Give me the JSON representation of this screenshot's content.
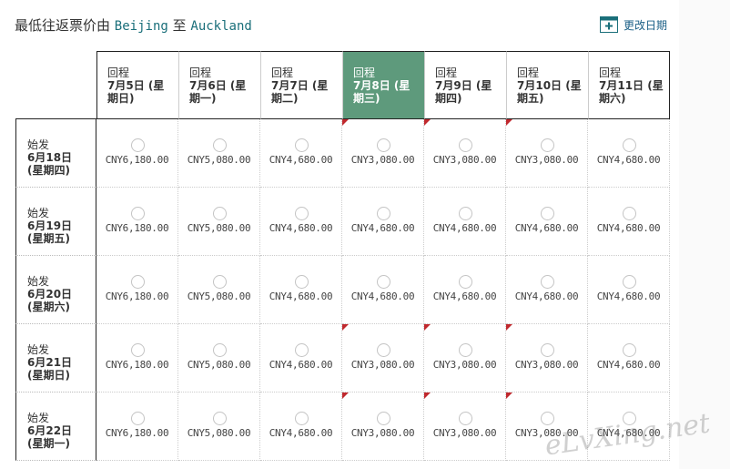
{
  "header": {
    "title_prefix": "最低往返票价由",
    "origin": "Beijing",
    "to": "至",
    "destination": "Auckland",
    "change_date_label": "更改日期"
  },
  "colors": {
    "selected_header": "#5e9a7c",
    "flag": "#c0282d",
    "link": "#1a5f86"
  },
  "columns": [
    {
      "dir": "回程",
      "date": "7月5日 (星期日)"
    },
    {
      "dir": "回程",
      "date": "7月6日 (星期一)"
    },
    {
      "dir": "回程",
      "date": "7月7日 (星期二)"
    },
    {
      "dir": "回程",
      "date": "7月8日 (星期三)",
      "selected": true
    },
    {
      "dir": "回程",
      "date": "7月9日 (星期四)"
    },
    {
      "dir": "回程",
      "date": "7月10日 (星期五)"
    },
    {
      "dir": "回程",
      "date": "7月11日 (星期六)"
    }
  ],
  "rows": [
    {
      "dir": "始发",
      "date": "6月18日 (星期四)",
      "prices": [
        "CNY6,180.00",
        "CNY5,080.00",
        "CNY4,680.00",
        "CNY3,080.00",
        "CNY3,080.00",
        "CNY3,080.00",
        "CNY4,680.00"
      ],
      "flags": [
        false,
        false,
        false,
        true,
        true,
        true,
        false
      ]
    },
    {
      "dir": "始发",
      "date": "6月19日 (星期五)",
      "prices": [
        "CNY6,180.00",
        "CNY5,080.00",
        "CNY4,680.00",
        "CNY4,680.00",
        "CNY4,680.00",
        "CNY4,680.00",
        "CNY4,680.00"
      ],
      "flags": [
        false,
        false,
        false,
        false,
        false,
        false,
        false
      ]
    },
    {
      "dir": "始发",
      "date": "6月20日 (星期六)",
      "prices": [
        "CNY6,180.00",
        "CNY5,080.00",
        "CNY4,680.00",
        "CNY4,680.00",
        "CNY4,680.00",
        "CNY4,680.00",
        "CNY4,680.00"
      ],
      "flags": [
        false,
        false,
        false,
        false,
        false,
        false,
        false
      ]
    },
    {
      "dir": "始发",
      "date": "6月21日 (星期日)",
      "prices": [
        "CNY6,180.00",
        "CNY5,080.00",
        "CNY4,680.00",
        "CNY3,080.00",
        "CNY3,080.00",
        "CNY3,080.00",
        "CNY4,680.00"
      ],
      "flags": [
        false,
        false,
        false,
        true,
        true,
        true,
        false
      ]
    },
    {
      "dir": "始发",
      "date": "6月22日 (星期一)",
      "prices": [
        "CNY6,180.00",
        "CNY5,080.00",
        "CNY4,680.00",
        "CNY3,080.00",
        "CNY3,080.00",
        "CNY3,080.00",
        "CNY4,680.00"
      ],
      "flags": [
        false,
        false,
        false,
        true,
        true,
        true,
        false
      ]
    }
  ],
  "watermark": "eLvXing.net"
}
